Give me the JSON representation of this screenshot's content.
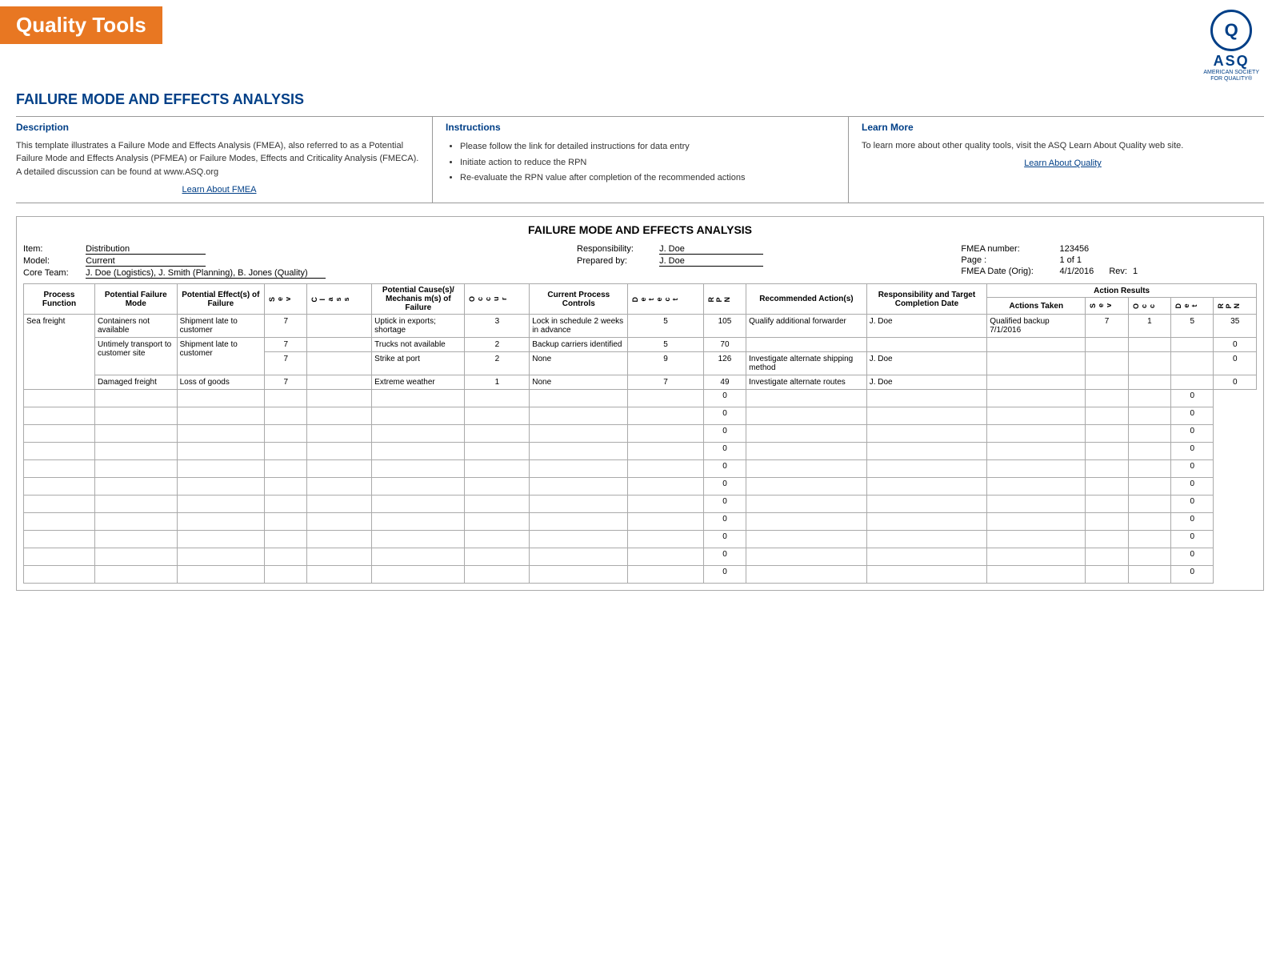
{
  "header": {
    "banner_text": "Quality Tools",
    "title": "Failure Mode and Effects Analysis",
    "asq_circle": "Q",
    "asq_name": "ASQ",
    "asq_subtitle": "AMERICAN SOCIETY\nFOR QUALITY"
  },
  "info_columns": {
    "description": {
      "header": "Description",
      "text": "This template illustrates a Failure Mode and Effects Analysis (FMEA), also referred to as a Potential Failure Mode and Effects Analysis (PFMEA) or Failure Modes, Effects and Criticality Analysis (FMECA).  A detailed discussion can be found at www.ASQ.org",
      "link": "Learn About FMEA"
    },
    "instructions": {
      "header": "Instructions",
      "bullets": [
        "Please follow the link for detailed instructions for data entry",
        "Initiate action to reduce the RPN",
        "Re-evaluate the RPN value after completion of the recommended actions"
      ]
    },
    "learn_more": {
      "header": "Learn More",
      "text": "To learn more about other quality tools, visit the ASQ Learn About Quality web site.",
      "link": "Learn About Quality"
    }
  },
  "fmea": {
    "table_title": "FAILURE MODE AND EFFECTS ANALYSIS",
    "item_label": "Item:",
    "item_value": "Distribution",
    "model_label": "Model:",
    "model_value": "Current",
    "core_team_label": "Core Team:",
    "core_team_value": "J. Doe (Logistics), J. Smith (Planning), B. Jones (Quality)",
    "responsibility_label": "Responsibility:",
    "responsibility_value": "J. Doe",
    "prepared_by_label": "Prepared by:",
    "prepared_by_value": "J. Doe",
    "fmea_number_label": "FMEA number:",
    "fmea_number_value": "123456",
    "page_label": "Page :",
    "page_value": "1 of 1",
    "fmea_date_label": "FMEA Date (Orig):",
    "fmea_date_value": "4/1/2016",
    "rev_label": "Rev:",
    "rev_value": "1",
    "col_headers": {
      "process_function": "Process Function",
      "potential_failure_mode": "Potential Failure Mode",
      "potential_effects": "Potential Effect(s) of Failure",
      "sev": "S e v",
      "cls": "C l a s s",
      "occ": "O c c u r",
      "potential_causes": "Potential Cause(s)/ Mechanis m(s) of Failure",
      "det": "D e t e c t",
      "current_controls": "Current Process Controls",
      "d_e_t_e": "D e t e",
      "rpn": "R P N",
      "recommended_actions": "Recommended Action(s)",
      "responsibility_target": "Responsibility and Target Completion Date",
      "actions_taken": "Actions Taken",
      "sev2": "S e v",
      "occ2": "O c c",
      "det2": "D e t",
      "rpn2": "R P N",
      "action_results": "Action Results"
    },
    "rows": [
      {
        "process_function": "Sea freight",
        "failure_mode": "Containers not available",
        "effects": "Shipment late to customer",
        "sev": "7",
        "cls": "",
        "potential_causes": "Uptick in exports; shortage",
        "occ": "3",
        "current_controls": "Lock in schedule 2 weeks in advance",
        "det": "5",
        "rpn": "105",
        "recommended_actions": "Qualify additional forwarder",
        "responsibility": "J. Doe",
        "actions_taken": "Qualified backup 7/1/2016",
        "sev2": "7",
        "occ2": "1",
        "det2": "5",
        "rpn2": "35"
      },
      {
        "process_function": "",
        "failure_mode": "Untimely transport to customer site",
        "effects": "Shipment late to customer",
        "sev": "7",
        "cls": "",
        "potential_causes": "Trucks not available",
        "occ": "2",
        "current_controls": "Backup carriers identified",
        "det": "5",
        "rpn": "70",
        "recommended_actions": "",
        "responsibility": "",
        "actions_taken": "",
        "sev2": "",
        "occ2": "",
        "det2": "",
        "rpn2": "0"
      },
      {
        "process_function": "",
        "failure_mode": "",
        "effects": "",
        "sev": "7",
        "cls": "",
        "potential_causes": "Strike at port",
        "occ": "2",
        "current_controls": "None",
        "det": "9",
        "rpn": "126",
        "recommended_actions": "Investigate alternate shipping method",
        "responsibility": "J. Doe",
        "actions_taken": "",
        "sev2": "",
        "occ2": "",
        "det2": "",
        "rpn2": "0"
      },
      {
        "process_function": "",
        "failure_mode": "Damaged freight",
        "effects": "Loss of goods",
        "sev": "7",
        "cls": "",
        "potential_causes": "Extreme weather",
        "occ": "1",
        "current_controls": "None",
        "det": "7",
        "rpn": "49",
        "recommended_actions": "Investigate alternate routes",
        "responsibility": "J. Doe",
        "actions_taken": "",
        "sev2": "",
        "occ2": "",
        "det2": "",
        "rpn2": "0"
      },
      {
        "process_function": "",
        "failure_mode": "",
        "effects": "",
        "sev": "",
        "cls": "",
        "potential_causes": "",
        "occ": "",
        "current_controls": "",
        "det": "",
        "rpn": "0",
        "recommended_actions": "",
        "responsibility": "",
        "actions_taken": "",
        "sev2": "",
        "occ2": "",
        "det2": "",
        "rpn2": "0"
      },
      {
        "process_function": "",
        "failure_mode": "",
        "effects": "",
        "sev": "",
        "cls": "",
        "potential_causes": "",
        "occ": "",
        "current_controls": "",
        "det": "",
        "rpn": "0",
        "recommended_actions": "",
        "responsibility": "",
        "actions_taken": "",
        "sev2": "",
        "occ2": "",
        "det2": "",
        "rpn2": "0"
      },
      {
        "process_function": "",
        "failure_mode": "",
        "effects": "",
        "sev": "",
        "cls": "",
        "potential_causes": "",
        "occ": "",
        "current_controls": "",
        "det": "",
        "rpn": "0",
        "recommended_actions": "",
        "responsibility": "",
        "actions_taken": "",
        "sev2": "",
        "occ2": "",
        "det2": "",
        "rpn2": "0"
      },
      {
        "process_function": "",
        "failure_mode": "",
        "effects": "",
        "sev": "",
        "cls": "",
        "potential_causes": "",
        "occ": "",
        "current_controls": "",
        "det": "",
        "rpn": "0",
        "recommended_actions": "",
        "responsibility": "",
        "actions_taken": "",
        "sev2": "",
        "occ2": "",
        "det2": "",
        "rpn2": "0"
      },
      {
        "process_function": "",
        "failure_mode": "",
        "effects": "",
        "sev": "",
        "cls": "",
        "potential_causes": "",
        "occ": "",
        "current_controls": "",
        "det": "",
        "rpn": "0",
        "recommended_actions": "",
        "responsibility": "",
        "actions_taken": "",
        "sev2": "",
        "occ2": "",
        "det2": "",
        "rpn2": "0"
      },
      {
        "process_function": "",
        "failure_mode": "",
        "effects": "",
        "sev": "",
        "cls": "",
        "potential_causes": "",
        "occ": "",
        "current_controls": "",
        "det": "",
        "rpn": "0",
        "recommended_actions": "",
        "responsibility": "",
        "actions_taken": "",
        "sev2": "",
        "occ2": "",
        "det2": "",
        "rpn2": "0"
      },
      {
        "process_function": "",
        "failure_mode": "",
        "effects": "",
        "sev": "",
        "cls": "",
        "potential_causes": "",
        "occ": "",
        "current_controls": "",
        "det": "",
        "rpn": "0",
        "recommended_actions": "",
        "responsibility": "",
        "actions_taken": "",
        "sev2": "",
        "occ2": "",
        "det2": "",
        "rpn2": "0"
      }
    ]
  }
}
